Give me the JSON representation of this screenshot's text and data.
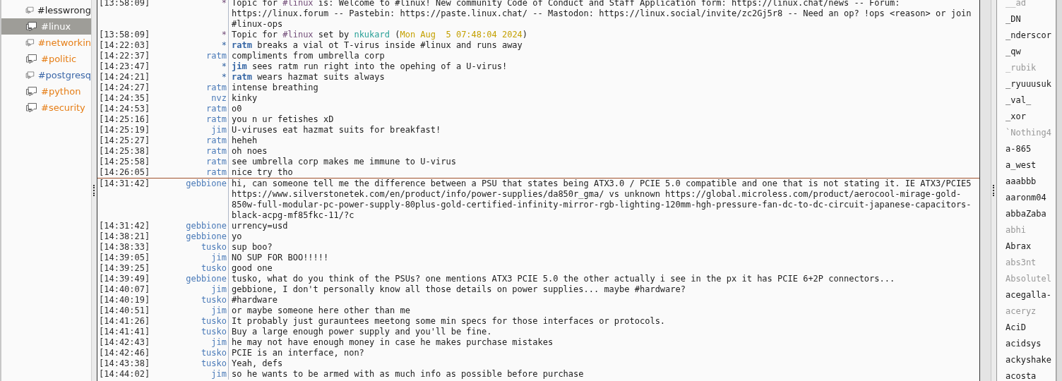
{
  "channels": [
    {
      "name": "#lesswrong",
      "selected": false,
      "color": "#222222"
    },
    {
      "name": "#linux",
      "selected": true,
      "color": "#ffffff"
    },
    {
      "name": "#networkin",
      "selected": false,
      "color": "#e67e16"
    },
    {
      "name": "#politic",
      "selected": false,
      "color": "#e67e16"
    },
    {
      "name": "#postgresq",
      "selected": false,
      "color": "#3b67a8"
    },
    {
      "name": "#python",
      "selected": false,
      "color": "#e67e16"
    },
    {
      "name": "#security",
      "selected": false,
      "color": "#e67e16"
    }
  ],
  "messages": [
    {
      "kind": "topic",
      "time": "[13:58:09]",
      "nick": "*",
      "parts": [
        {
          "kind": "plain",
          "text": "Topic for "
        },
        {
          "kind": "channel",
          "text": "#linux"
        },
        {
          "kind": "plain",
          "text": " is: Welcome to #linux! New community Code of Conduct and Staff Application form: https://linux.chat/news -- Forum: https://linux.forum -- Pastebin: https://paste.linux.chat/ -- Mastodon: https://linux.social/invite/zc2Gj5r8 -- Need an op? !ops <reason> or join #linux-ops"
        }
      ]
    },
    {
      "kind": "topic",
      "time": "[13:58:09]",
      "nick": "*",
      "parts": [
        {
          "kind": "plain",
          "text": "Topic for "
        },
        {
          "kind": "channel",
          "text": "#linux"
        },
        {
          "kind": "plain",
          "text": " set by "
        },
        {
          "kind": "setter",
          "text": "nkukard"
        },
        {
          "kind": "plain",
          "text": " ("
        },
        {
          "kind": "date",
          "text": "Mon Aug  5 07:48:04 2024"
        },
        {
          "kind": "plain",
          "text": ")"
        }
      ]
    },
    {
      "kind": "action",
      "time": "[14:22:03]",
      "nick": "*",
      "parts": [
        {
          "kind": "nick",
          "text": "ratm"
        },
        {
          "kind": "plain",
          "text": " breaks a vial ot T-virus inside #linux and runs away"
        }
      ]
    },
    {
      "kind": "message",
      "time": "[14:22:37]",
      "nick": "ratm",
      "parts": [
        {
          "kind": "plain",
          "text": "compliments from umbrella corp"
        }
      ]
    },
    {
      "kind": "action",
      "time": "[14:23:47]",
      "nick": "*",
      "parts": [
        {
          "kind": "nick",
          "text": "jim"
        },
        {
          "kind": "plain",
          "text": " sees ratm run right into the opehing of a U-virus!"
        }
      ]
    },
    {
      "kind": "action",
      "time": "[14:24:21]",
      "nick": "*",
      "parts": [
        {
          "kind": "nick",
          "text": "ratm"
        },
        {
          "kind": "plain",
          "text": " wears hazmat suits always"
        }
      ]
    },
    {
      "kind": "message",
      "time": "[14:24:27]",
      "nick": "ratm",
      "parts": [
        {
          "kind": "plain",
          "text": "intense breathing"
        }
      ]
    },
    {
      "kind": "message",
      "time": "[14:24:35]",
      "nick": "nvz",
      "parts": [
        {
          "kind": "plain",
          "text": "kinky"
        }
      ]
    },
    {
      "kind": "message",
      "time": "[14:24:53]",
      "nick": "ratm",
      "parts": [
        {
          "kind": "plain",
          "text": "o0"
        }
      ]
    },
    {
      "kind": "message",
      "time": "[14:25:16]",
      "nick": "ratm",
      "parts": [
        {
          "kind": "plain",
          "text": "you n ur fetishes xD"
        }
      ]
    },
    {
      "kind": "message",
      "time": "[14:25:19]",
      "nick": "jim",
      "parts": [
        {
          "kind": "plain",
          "text": "U-viruses eat hazmat suits for breakfast!"
        }
      ]
    },
    {
      "kind": "message",
      "time": "[14:25:27]",
      "nick": "ratm",
      "parts": [
        {
          "kind": "plain",
          "text": "heheh"
        }
      ]
    },
    {
      "kind": "message",
      "time": "[14:25:38]",
      "nick": "ratm",
      "parts": [
        {
          "kind": "plain",
          "text": "oh noes"
        }
      ]
    },
    {
      "kind": "message",
      "time": "[14:25:58]",
      "nick": "ratm",
      "parts": [
        {
          "kind": "plain",
          "text": "see umbrella corp makes me immune to U-virus"
        }
      ]
    },
    {
      "kind": "message",
      "time": "[14:26:05]",
      "nick": "ratm",
      "parts": [
        {
          "kind": "plain",
          "text": "nice try tho"
        }
      ]
    },
    {
      "kind": "marker"
    },
    {
      "kind": "message",
      "time": "[14:31:42]",
      "nick": "gebbione",
      "parts": [
        {
          "kind": "plain",
          "text": "hi, can someone tell me the difference between a PSU that states being ATX3.0 / PCIE 5.0 compatible and one that is not stating it. IE ATX3/PCIE5 https://www.silverstonetek.com/en/product/info/power-supplies/da850r_gma/ vs unknown https://global.microless.com/product/aerocool-mirage-gold-850w-full-modular-pc-power-supply-80plus-gold-certified-infinity-mirror-rgb-lighting-120mm-hgh-pressure-fan-dc-to-dc-circuit-japanese-capacitors-black-acpg-mf85fkc-11/?c"
        }
      ]
    },
    {
      "kind": "message",
      "time": "[14:31:42]",
      "nick": "gebbione",
      "parts": [
        {
          "kind": "plain",
          "text": "urrency=usd"
        }
      ]
    },
    {
      "kind": "message",
      "time": "[14:38:21]",
      "nick": "gebbione",
      "parts": [
        {
          "kind": "plain",
          "text": "yo"
        }
      ]
    },
    {
      "kind": "message",
      "time": "[14:38:33]",
      "nick": "tusko",
      "parts": [
        {
          "kind": "plain",
          "text": "sup boo?"
        }
      ]
    },
    {
      "kind": "message",
      "time": "[14:39:05]",
      "nick": "jim",
      "parts": [
        {
          "kind": "plain",
          "text": "NO SUP FOR BOO!!!!!"
        }
      ]
    },
    {
      "kind": "message",
      "time": "[14:39:25]",
      "nick": "tusko",
      "parts": [
        {
          "kind": "plain",
          "text": "good one"
        }
      ]
    },
    {
      "kind": "message",
      "time": "[14:39:49]",
      "nick": "gebbione",
      "parts": [
        {
          "kind": "plain",
          "text": "tusko, what do you think of the PSUs? one mentions ATX3 PCIE 5.0 the other actually i see in the px it has PCIE 6+2P connectors..."
        }
      ]
    },
    {
      "kind": "message",
      "time": "[14:40:07]",
      "nick": "jim",
      "parts": [
        {
          "kind": "plain",
          "text": "gebbione, I don't personally know all those details on power supplies... maybe #hardware?"
        }
      ]
    },
    {
      "kind": "message",
      "time": "[14:40:19]",
      "nick": "tusko",
      "parts": [
        {
          "kind": "plain",
          "text": "#hardware"
        }
      ]
    },
    {
      "kind": "message",
      "time": "[14:40:51]",
      "nick": "jim",
      "parts": [
        {
          "kind": "plain",
          "text": "or maybe someone here other than me"
        }
      ]
    },
    {
      "kind": "message",
      "time": "[14:41:26]",
      "nick": "tusko",
      "parts": [
        {
          "kind": "plain",
          "text": "It probably just gurauntees meetong some min specs for those interfaces or protocols."
        }
      ]
    },
    {
      "kind": "message",
      "time": "[14:41:41]",
      "nick": "tusko",
      "parts": [
        {
          "kind": "plain",
          "text": "Buy a large enough power supply and you'll be fine."
        }
      ]
    },
    {
      "kind": "message",
      "time": "[14:42:43]",
      "nick": "jim",
      "parts": [
        {
          "kind": "plain",
          "text": "he may not have enough money in case he makes purchase mistakes"
        }
      ]
    },
    {
      "kind": "message",
      "time": "[14:42:46]",
      "nick": "tusko",
      "parts": [
        {
          "kind": "plain",
          "text": "PCIE is an interface, non?"
        }
      ]
    },
    {
      "kind": "message",
      "time": "[14:43:38]",
      "nick": "tusko",
      "parts": [
        {
          "kind": "plain",
          "text": "Yeah, defs"
        }
      ]
    },
    {
      "kind": "message",
      "time": "[14:44:02]",
      "nick": "jim",
      "parts": [
        {
          "kind": "plain",
          "text": "so he wants to be armed with as much info as possible before purchase"
        }
      ]
    }
  ],
  "users": [
    {
      "name": "__ad",
      "away": true
    },
    {
      "name": "_DN",
      "away": false
    },
    {
      "name": "_nderscor",
      "away": false
    },
    {
      "name": "_qw",
      "away": false
    },
    {
      "name": "_rubik",
      "away": true
    },
    {
      "name": "_ryuuusuk",
      "away": false
    },
    {
      "name": "_val_",
      "away": false
    },
    {
      "name": "_xor",
      "away": false
    },
    {
      "name": "`Nothing4",
      "away": true
    },
    {
      "name": "a-865",
      "away": false
    },
    {
      "name": "a_west",
      "away": false
    },
    {
      "name": "aaabbb",
      "away": false
    },
    {
      "name": "aaronm04",
      "away": false
    },
    {
      "name": "abbaZaba",
      "away": false
    },
    {
      "name": "abhi",
      "away": true
    },
    {
      "name": "Abrax",
      "away": false
    },
    {
      "name": "abs3nt",
      "away": true
    },
    {
      "name": "Absolutel",
      "away": true
    },
    {
      "name": "acegalla-",
      "away": false
    },
    {
      "name": "aceryz",
      "away": true
    },
    {
      "name": "AciD",
      "away": false
    },
    {
      "name": "acidsys",
      "away": false
    },
    {
      "name": "ackyshake",
      "away": false
    },
    {
      "name": "acosta",
      "away": false
    }
  ]
}
